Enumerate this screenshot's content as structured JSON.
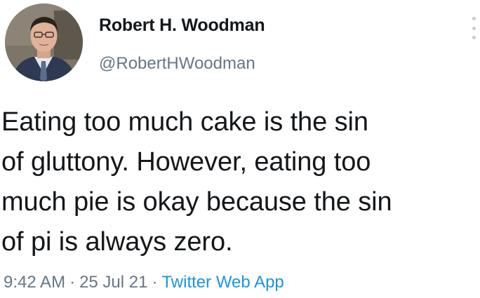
{
  "tweet": {
    "author": {
      "display_name": "Robert H. Woodman",
      "handle": "@RobertHWoodman",
      "avatar_icon": "profile-photo"
    },
    "text_lines": [
      "Eating too much cake is the sin",
      "of gluttony. However, eating too",
      "much pie is okay because the sin",
      "of pi is always zero."
    ],
    "time": "9:42 AM",
    "separator": "·",
    "date": "25 Jul 21",
    "source": "Twitter Web App"
  },
  "colors": {
    "text_primary": "#14171a",
    "text_secondary": "#657786",
    "link": "#1b95e0",
    "background": "#ffffff"
  },
  "icons": {
    "more": "more-options-icon"
  }
}
